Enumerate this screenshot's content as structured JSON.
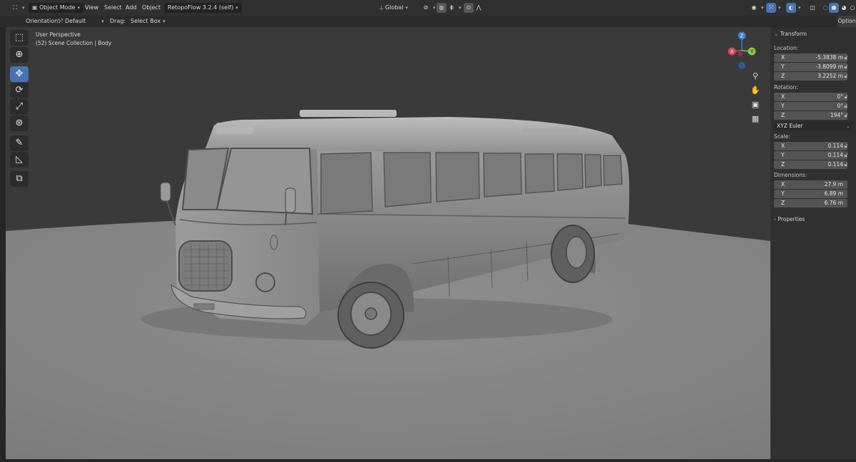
{
  "header": {
    "mode": "Object Mode",
    "menu": [
      "View",
      "Select",
      "Add",
      "Object"
    ],
    "addon": "RetopoFlow 3.2.4 (self)",
    "transform_orientation": "Global"
  },
  "tool_header": {
    "orientation_label": "Orientation:",
    "orientation_value": "Default",
    "drag_label": "Drag:",
    "drag_value": "Select Box",
    "options_label": "Option"
  },
  "viewport": {
    "view_name": "User Perspective",
    "collection_info": "(52) Scene Collection | Body"
  },
  "gizmo": {
    "x": "X",
    "y": "Y",
    "z": "Z"
  },
  "toolbar": [
    "select-box-tool",
    "cursor-tool",
    "move-tool",
    "rotate-tool",
    "scale-tool",
    "transform-tool",
    "annotate-tool",
    "measure-tool",
    "add-cube-tool"
  ],
  "sidebar": {
    "panel_title": "Transform",
    "location_label": "Location:",
    "location": [
      {
        "axis": "X",
        "value": "-5.3838 m"
      },
      {
        "axis": "Y",
        "value": "-3.8099 m"
      },
      {
        "axis": "Z",
        "value": "3.2252 m"
      }
    ],
    "rotation_label": "Rotation:",
    "rotation": [
      {
        "axis": "X",
        "value": "0°"
      },
      {
        "axis": "Y",
        "value": "0°"
      },
      {
        "axis": "Z",
        "value": "194°"
      }
    ],
    "rotation_mode": "XYZ Euler",
    "scale_label": "Scale:",
    "scale": [
      {
        "axis": "X",
        "value": "0.114"
      },
      {
        "axis": "Y",
        "value": "0.114"
      },
      {
        "axis": "Z",
        "value": "0.114"
      }
    ],
    "dimensions_label": "Dimensions:",
    "dimensions": [
      {
        "axis": "X",
        "value": "27.9 m"
      },
      {
        "axis": "Y",
        "value": "6.89 m"
      },
      {
        "axis": "Z",
        "value": "6.76 m"
      }
    ],
    "properties_label": "Properties"
  },
  "colors": {
    "accent": "#4772b3",
    "x_axis": "#e0455a",
    "y_axis": "#8bc53f",
    "z_axis": "#3b7fd6"
  }
}
